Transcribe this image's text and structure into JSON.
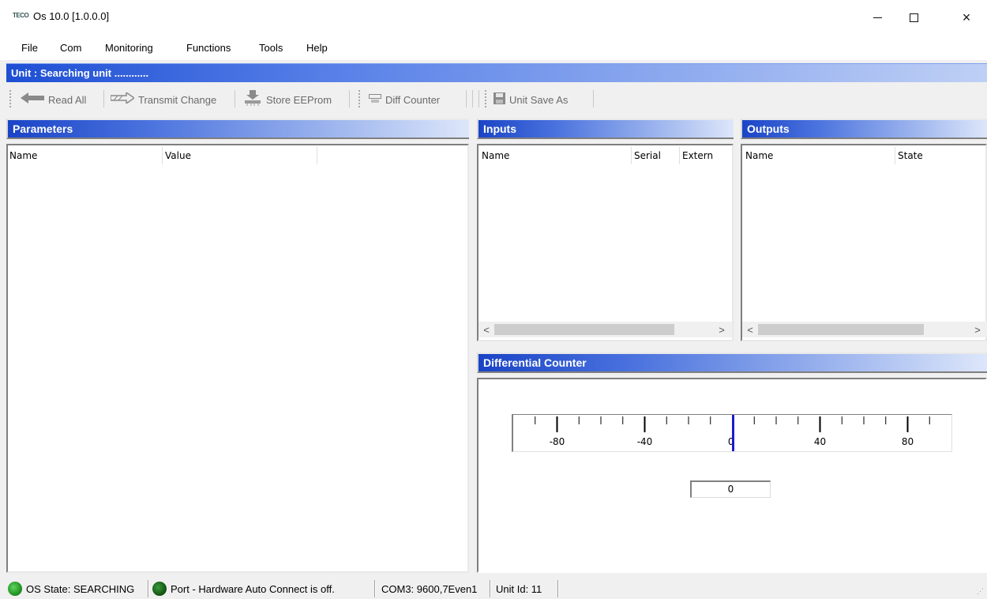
{
  "window": {
    "title": "Os 10.0 [1.0.0.0]",
    "icon": "app-logo-icon",
    "icon_text": "TECO",
    "controls": {
      "minimize": "minimize-icon",
      "maximize": "maximize-icon",
      "close": "×"
    }
  },
  "menu": [
    "File",
    "Com",
    "Monitoring",
    "Functions",
    "Tools",
    "Help"
  ],
  "unit_bar": {
    "text": "Unit : Searching unit ............"
  },
  "toolbar": {
    "read_all": "Read All",
    "transmit_change": "Transmit Change",
    "store_eeprom": "Store EEProm",
    "diff_counter": "Diff Counter",
    "unit_save_as": "Unit Save As"
  },
  "parameters": {
    "title": "Parameters",
    "columns": [
      "Name",
      "Value"
    ],
    "rows": []
  },
  "inputs": {
    "title": "Inputs",
    "columns": [
      "Name",
      "Serial",
      "Extern"
    ],
    "rows": []
  },
  "outputs": {
    "title": "Outputs",
    "columns": [
      "Name",
      "State"
    ],
    "rows": []
  },
  "differential_counter": {
    "title": "Differential Counter",
    "scale": {
      "min": -100,
      "max": 100,
      "major_step": 40,
      "minor_step": 10,
      "labels": [
        "-80",
        "-40",
        "0",
        "40",
        "80"
      ]
    },
    "needle_value": 0,
    "counter_value": "0"
  },
  "statusbar": {
    "os_state": "OS State: SEARCHING",
    "port": "Port - Hardware Auto Connect is off.",
    "com": "COM3: 9600,7Even1",
    "unit_id": "Unit Id: 11"
  },
  "colors": {
    "header_gradient_start": "#1a44c6",
    "header_gradient_end": "#dde6fa",
    "needle": "#1c1ccc",
    "led_green": "#1a8a1a"
  }
}
